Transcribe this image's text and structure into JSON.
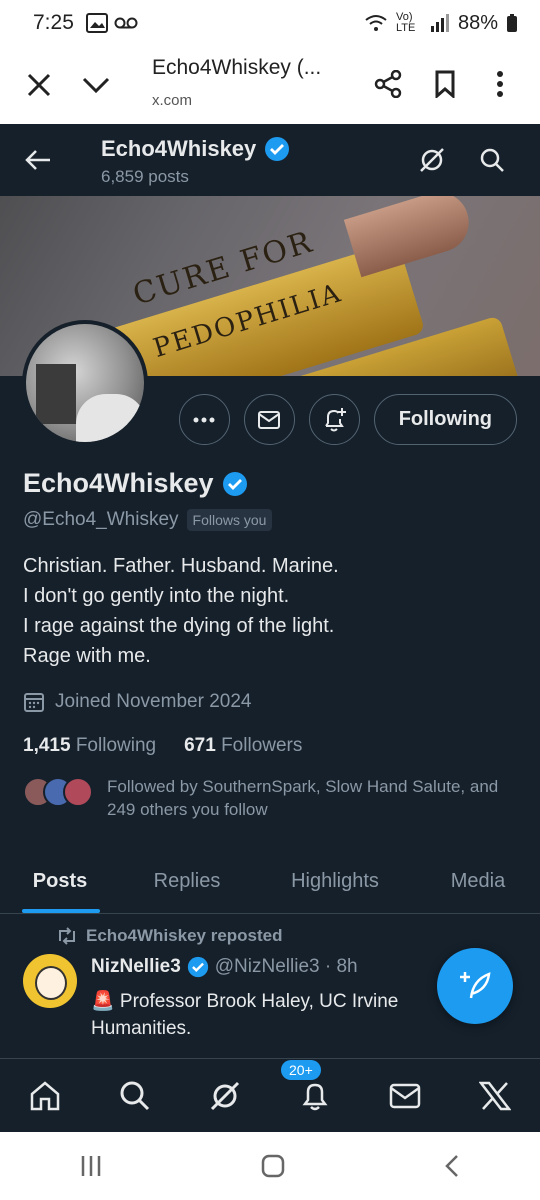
{
  "status": {
    "time": "7:25",
    "battery": "88%",
    "network": "Vo) LTE"
  },
  "browser": {
    "title": "Echo4Whiskey (...",
    "url": "x.com"
  },
  "header": {
    "name": "Echo4Whiskey",
    "posts": "6,859 posts"
  },
  "banner": {
    "line1": "CURE FOR",
    "line2": "PEDOPHILIA"
  },
  "profile": {
    "name": "Echo4Whiskey",
    "handle": "@Echo4_Whiskey",
    "follows_you": "Follows you",
    "bio": [
      "Christian. Father. Husband. Marine.",
      "I don't go gently into the night.",
      "I rage against the dying of the light.",
      "Rage with me."
    ],
    "joined": "Joined November 2024",
    "following_count": "1,415",
    "following_label": "Following",
    "followers_count": "671",
    "followers_label": "Followers",
    "followed_by": "Followed by SouthernSpark, Slow Hand Salute, and 249 others you follow",
    "following_button": "Following"
  },
  "tabs": [
    "Posts",
    "Replies",
    "Highlights",
    "Media"
  ],
  "tweet": {
    "repost_label": "Echo4Whiskey reposted",
    "name": "NizNellie3",
    "handle": "@NizNellie3 · 8h",
    "body": "🚨 Professor Brook Haley, UC Irvine Humanities."
  },
  "nav": {
    "badge": "20+"
  },
  "colors": {
    "accent": "#1d9bf0",
    "background": "#15202b"
  }
}
